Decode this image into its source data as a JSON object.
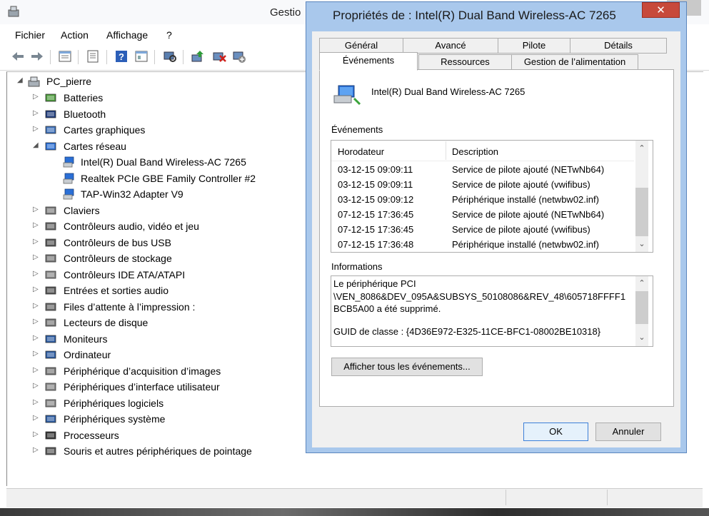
{
  "device_manager": {
    "title": "Gestio",
    "menu": [
      "Fichier",
      "Action",
      "Affichage",
      "?"
    ],
    "toolbar_icons": [
      "back-icon",
      "forward-icon",
      "properties-list-icon",
      "view-icon",
      "details-icon",
      "help-icon",
      "view-pane-icon",
      "scan-hardware-icon",
      "update-driver-icon",
      "disable-icon",
      "uninstall-icon"
    ],
    "tree": {
      "root": "PC_pierre",
      "categories": [
        {
          "label": "Batteries",
          "icon": "battery-icon",
          "expanded": false
        },
        {
          "label": "Bluetooth",
          "icon": "bluetooth-icon",
          "expanded": false
        },
        {
          "label": "Cartes graphiques",
          "icon": "display-adapter-icon",
          "expanded": false
        },
        {
          "label": "Cartes réseau",
          "icon": "network-adapter-icon",
          "expanded": true,
          "children": [
            "Intel(R) Dual Band Wireless-AC 7265",
            "Realtek PCIe GBE Family Controller #2",
            "TAP-Win32 Adapter V9"
          ]
        },
        {
          "label": "Claviers",
          "icon": "keyboard-icon",
          "expanded": false
        },
        {
          "label": "Contrôleurs audio, vidéo et jeu",
          "icon": "speaker-icon",
          "expanded": false
        },
        {
          "label": "Contrôleurs de bus USB",
          "icon": "usb-icon",
          "expanded": false
        },
        {
          "label": "Contrôleurs de stockage",
          "icon": "storage-controller-icon",
          "expanded": false
        },
        {
          "label": "Contrôleurs IDE ATA/ATAPI",
          "icon": "ide-controller-icon",
          "expanded": false
        },
        {
          "label": "Entrées et sorties audio",
          "icon": "audio-io-icon",
          "expanded": false
        },
        {
          "label": "Files d’attente à l’impression :",
          "icon": "printer-icon",
          "expanded": false
        },
        {
          "label": "Lecteurs de disque",
          "icon": "disk-drive-icon",
          "expanded": false
        },
        {
          "label": "Moniteurs",
          "icon": "monitor-icon",
          "expanded": false
        },
        {
          "label": "Ordinateur",
          "icon": "computer-icon",
          "expanded": false
        },
        {
          "label": "Périphérique d’acquisition d’images",
          "icon": "scanner-icon",
          "expanded": false
        },
        {
          "label": "Périphériques d’interface utilisateur",
          "icon": "hid-icon",
          "expanded": false
        },
        {
          "label": "Périphériques logiciels",
          "icon": "software-device-icon",
          "expanded": false
        },
        {
          "label": "Périphériques système",
          "icon": "system-device-icon",
          "expanded": false
        },
        {
          "label": "Processeurs",
          "icon": "processor-icon",
          "expanded": false
        },
        {
          "label": "Souris et autres périphériques de pointage",
          "icon": "mouse-icon",
          "expanded": false
        }
      ]
    }
  },
  "dialog": {
    "title": "Propriétés de : Intel(R) Dual Band Wireless-AC 7265",
    "close_glyph": "✕",
    "tabs_back": [
      "Général",
      "Avancé",
      "Pilote",
      "Détails"
    ],
    "tabs_front": [
      "Événements",
      "Ressources",
      "Gestion de l’alimentation"
    ],
    "active_tab": "Événements",
    "device_name": "Intel(R) Dual Band Wireless-AC 7265",
    "events_label": "Événements",
    "events_columns": [
      "Horodateur",
      "Description"
    ],
    "events": [
      {
        "time": "03-12-15 09:09:11",
        "desc": "Service de pilote ajouté (NETwNb64)"
      },
      {
        "time": "03-12-15 09:09:11",
        "desc": "Service de pilote ajouté (vwifibus)"
      },
      {
        "time": "03-12-15 09:09:12",
        "desc": "Périphérique installé (netwbw02.inf)"
      },
      {
        "time": "07-12-15 17:36:45",
        "desc": "Service de pilote ajouté (NETwNb64)"
      },
      {
        "time": "07-12-15 17:36:45",
        "desc": "Service de pilote ajouté (vwifibus)"
      },
      {
        "time": "07-12-15 17:36:48",
        "desc": "Périphérique installé (netwbw02.inf)"
      }
    ],
    "info_label": "Informations",
    "info_lines": [
      "Le périphérique PCI",
      "\\VEN_8086&DEV_095A&SUBSYS_50108086&REV_48\\605718FFFF1",
      "BCB5A00 a été supprimé.",
      "",
      "GUID de classe : {4D36E972-E325-11CE-BFC1-08002BE10318}"
    ],
    "show_all_button": "Afficher tous les événements...",
    "ok_button": "OK",
    "cancel_button": "Annuler"
  },
  "colors": {
    "dialog_frame": "#a9c8ec",
    "close_button": "#c7493b",
    "default_button_border": "#3c7fd8"
  }
}
